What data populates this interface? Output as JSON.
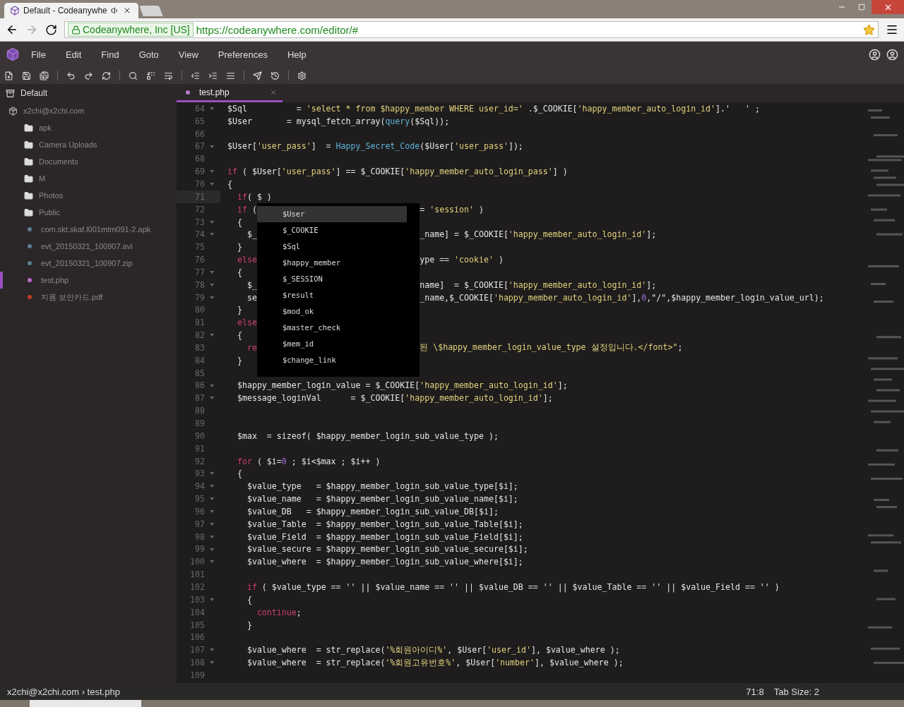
{
  "browser": {
    "tab_title": "Default - Codeanywhe",
    "address_owner": "Codeanywhere, Inc [US]",
    "url": "https://codeanywhere.com/editor/#"
  },
  "menu": [
    {
      "label": "File"
    },
    {
      "label": "Edit"
    },
    {
      "label": "Find"
    },
    {
      "label": "Goto"
    },
    {
      "label": "View"
    },
    {
      "label": "Preferences"
    },
    {
      "label": "Help"
    }
  ],
  "sidebar": {
    "title": "Default",
    "account": "x2chi@x2chi.com",
    "items": [
      {
        "name": "apk",
        "kind": "folder",
        "selected": false
      },
      {
        "name": "Camera Uploads",
        "kind": "folder",
        "selected": false
      },
      {
        "name": "Documents",
        "kind": "folder",
        "selected": false
      },
      {
        "name": "M",
        "kind": "folder",
        "selected": false
      },
      {
        "name": "Photos",
        "kind": "folder",
        "selected": false
      },
      {
        "name": "Public",
        "kind": "folder",
        "selected": false
      },
      {
        "name": "com.skt.skaf.l001mtm091-2.apk",
        "kind": "file",
        "selected": false
      },
      {
        "name": "evt_20150321_100907.avi",
        "kind": "file",
        "selected": false
      },
      {
        "name": "evt_20150321_100907.zip",
        "kind": "file",
        "selected": false
      },
      {
        "name": "test.php",
        "kind": "php",
        "selected": true
      },
      {
        "name": "지름 보안카드.pdf",
        "kind": "pdf",
        "selected": false
      }
    ]
  },
  "editor_tabs": [
    {
      "label": "test.php",
      "selected": true
    }
  ],
  "code": {
    "lines": [
      {
        "number": "64",
        "fold": true,
        "active": false,
        "tokens": [
          {
            "kind": "plain",
            "text": "$Sql          = "
          },
          {
            "kind": "str",
            "text": "'select * from $happy_member WHERE user_id='"
          },
          {
            "kind": "plain",
            "text": " .$_COOKIE["
          },
          {
            "kind": "str",
            "text": "'happy_member_auto_login_id'"
          },
          {
            "kind": "plain",
            "text": "].'   ' ;"
          }
        ]
      },
      {
        "number": "65",
        "fold": false,
        "active": false,
        "tokens": [
          {
            "kind": "plain",
            "text": "$User       = mysql_fetch_array("
          },
          {
            "kind": "fn",
            "text": "query"
          },
          {
            "kind": "plain",
            "text": "($Sql));"
          }
        ]
      },
      {
        "number": "66",
        "fold": false,
        "active": false
      },
      {
        "number": "67",
        "fold": true,
        "active": false,
        "tokens": [
          {
            "kind": "plain",
            "text": "$User["
          },
          {
            "kind": "str",
            "text": "'user_pass'"
          },
          {
            "kind": "plain",
            "text": "]  = "
          },
          {
            "kind": "fn",
            "text": "Happy_Secret_Code"
          },
          {
            "kind": "plain",
            "text": "($User["
          },
          {
            "kind": "str",
            "text": "'user_pass'"
          },
          {
            "kind": "plain",
            "text": "]);"
          }
        ]
      },
      {
        "number": "68",
        "fold": false,
        "active": false
      },
      {
        "number": "69",
        "fold": true,
        "active": false,
        "tokens": [
          {
            "kind": "kw",
            "text": "if"
          },
          {
            "kind": "plain",
            "text": " ( $User["
          },
          {
            "kind": "str",
            "text": "'user_pass'"
          },
          {
            "kind": "plain",
            "text": "] == $_COOKIE["
          },
          {
            "kind": "str",
            "text": "'happy_member_auto_login_pass'"
          },
          {
            "kind": "plain",
            "text": "] )"
          }
        ]
      },
      {
        "number": "70",
        "fold": true,
        "active": false,
        "tokens": [
          {
            "kind": "plain",
            "text": "{"
          }
        ]
      },
      {
        "number": "71",
        "fold": false,
        "active": true,
        "tokens": [
          {
            "kind": "kw",
            "text": "  if"
          },
          {
            "kind": "plain",
            "text": "( $ )"
          }
        ]
      },
      {
        "number": "72",
        "fold": false,
        "active": false,
        "tokens": [
          {
            "kind": "kw",
            "text": "  if"
          },
          {
            "kind": "plain",
            "text": " ("
          }
        ],
        "after": [
          {
            "kind": "plain",
            "text": "= "
          },
          {
            "kind": "str",
            "text": "'session'"
          },
          {
            "kind": "plain",
            "text": " )"
          }
        ]
      },
      {
        "number": "73",
        "fold": true,
        "active": false,
        "tokens": [
          {
            "kind": "plain",
            "text": "  {"
          }
        ]
      },
      {
        "number": "74",
        "fold": true,
        "active": false,
        "tokens": [
          {
            "kind": "plain",
            "text": "    $_"
          }
        ],
        "after": [
          {
            "kind": "plain",
            "text": "_name] = $_COOKIE["
          },
          {
            "kind": "str",
            "text": "'happy_member_auto_login_id'"
          },
          {
            "kind": "plain",
            "text": "];"
          }
        ]
      },
      {
        "number": "75",
        "fold": false,
        "active": false,
        "tokens": [
          {
            "kind": "plain",
            "text": "  }"
          }
        ]
      },
      {
        "number": "76",
        "fold": false,
        "active": false,
        "tokens": [
          {
            "kind": "kw",
            "text": "  else"
          }
        ],
        "after": [
          {
            "kind": "plain",
            "text": "ype == "
          },
          {
            "kind": "str",
            "text": "'cookie'"
          },
          {
            "kind": "plain",
            "text": " )"
          }
        ]
      },
      {
        "number": "77",
        "fold": true,
        "active": false,
        "tokens": [
          {
            "kind": "plain",
            "text": "  {"
          }
        ]
      },
      {
        "number": "78",
        "fold": true,
        "active": false,
        "tokens": [
          {
            "kind": "plain",
            "text": "    $_"
          }
        ],
        "after": [
          {
            "kind": "plain",
            "text": "name]  = $_COOKIE["
          },
          {
            "kind": "str",
            "text": "'happy_member_auto_login_id'"
          },
          {
            "kind": "plain",
            "text": "];"
          }
        ]
      },
      {
        "number": "79",
        "fold": true,
        "active": false,
        "tokens": [
          {
            "kind": "plain",
            "text": "    se"
          }
        ],
        "after": [
          {
            "kind": "plain",
            "text": "_name,$_COOKIE["
          },
          {
            "kind": "str",
            "text": "'happy_member_auto_login_id'"
          },
          {
            "kind": "plain",
            "text": "],"
          },
          {
            "kind": "num",
            "text": "0"
          },
          {
            "kind": "plain",
            "text": ",\"/\",$happy_member_login_value_url);"
          }
        ]
      },
      {
        "number": "80",
        "fold": false,
        "active": false,
        "tokens": [
          {
            "kind": "plain",
            "text": "  }"
          }
        ]
      },
      {
        "number": "81",
        "fold": false,
        "active": false,
        "tokens": [
          {
            "kind": "kw",
            "text": "  else"
          }
        ]
      },
      {
        "number": "82",
        "fold": true,
        "active": false,
        "tokens": [
          {
            "kind": "plain",
            "text": "  {"
          }
        ]
      },
      {
        "number": "83",
        "fold": false,
        "active": false,
        "tokens": [
          {
            "kind": "kw",
            "text": "    re"
          }
        ],
        "after": [
          {
            "kind": "str",
            "text": "된 \\$happy_member_login_value_type 설정입니다.</font>\""
          },
          {
            "kind": "plain",
            "text": ";"
          }
        ]
      },
      {
        "number": "84",
        "fold": false,
        "active": false,
        "tokens": [
          {
            "kind": "plain",
            "text": "  }"
          }
        ]
      },
      {
        "number": "85",
        "fold": false,
        "active": false
      },
      {
        "number": "86",
        "fold": true,
        "active": false,
        "tokens": [
          {
            "kind": "plain",
            "text": "  $happy_member_login_value = $_COOKIE["
          },
          {
            "kind": "str",
            "text": "'happy_member_auto_login_id'"
          },
          {
            "kind": "plain",
            "text": "];"
          }
        ]
      },
      {
        "number": "87",
        "fold": true,
        "active": false,
        "tokens": [
          {
            "kind": "plain",
            "text": "  $message_loginVal      = $_COOKIE["
          },
          {
            "kind": "str",
            "text": "'happy_member_auto_login_id'"
          },
          {
            "kind": "plain",
            "text": "];"
          }
        ]
      },
      {
        "number": "88",
        "fold": false,
        "active": false
      },
      {
        "number": "89",
        "fold": false,
        "active": false
      },
      {
        "number": "90",
        "fold": false,
        "active": false,
        "tokens": [
          {
            "kind": "plain",
            "text": "  $max  = sizeof( $happy_member_login_sub_value_type );"
          }
        ]
      },
      {
        "number": "91",
        "fold": false,
        "active": false
      },
      {
        "number": "92",
        "fold": false,
        "active": false,
        "tokens": [
          {
            "kind": "kw",
            "text": "  for"
          },
          {
            "kind": "plain",
            "text": " ( $i="
          },
          {
            "kind": "num",
            "text": "0"
          },
          {
            "kind": "plain",
            "text": " ; $i<$max ; $i++ )"
          }
        ]
      },
      {
        "number": "93",
        "fold": true,
        "active": false,
        "tokens": [
          {
            "kind": "plain",
            "text": "  {"
          }
        ]
      },
      {
        "number": "94",
        "fold": true,
        "active": false,
        "tokens": [
          {
            "kind": "plain",
            "text": "    $value_type   = $happy_member_login_sub_value_type[$i];"
          }
        ]
      },
      {
        "number": "95",
        "fold": true,
        "active": false,
        "tokens": [
          {
            "kind": "plain",
            "text": "    $value_name   = $happy_member_login_sub_value_name[$i];"
          }
        ]
      },
      {
        "number": "96",
        "fold": true,
        "active": false,
        "tokens": [
          {
            "kind": "plain",
            "text": "    $value_DB   = $happy_member_login_sub_value_DB[$i];"
          }
        ]
      },
      {
        "number": "97",
        "fold": true,
        "active": false,
        "tokens": [
          {
            "kind": "plain",
            "text": "    $value_Table  = $happy_member_login_sub_value_Table[$i];"
          }
        ]
      },
      {
        "number": "98",
        "fold": true,
        "active": false,
        "tokens": [
          {
            "kind": "plain",
            "text": "    $value_Field  = $happy_member_login_sub_value_Field[$i];"
          }
        ]
      },
      {
        "number": "99",
        "fold": true,
        "active": false,
        "tokens": [
          {
            "kind": "plain",
            "text": "    $value_secure = $happy_member_login_sub_value_secure[$i];"
          }
        ]
      },
      {
        "number": "100",
        "fold": true,
        "active": false,
        "tokens": [
          {
            "kind": "plain",
            "text": "    $value_where  = $happy_member_login_sub_value_where[$i];"
          }
        ]
      },
      {
        "number": "101",
        "fold": false,
        "active": false
      },
      {
        "number": "102",
        "fold": false,
        "active": false,
        "tokens": [
          {
            "kind": "kw",
            "text": "    if"
          },
          {
            "kind": "plain",
            "text": " ( $value_type == '' || $value_name == '' || $value_DB == '' || $value_Table == '' || $value_Field == '' )"
          }
        ]
      },
      {
        "number": "103",
        "fold": true,
        "active": false,
        "tokens": [
          {
            "kind": "plain",
            "text": "    {"
          }
        ]
      },
      {
        "number": "104",
        "fold": false,
        "active": false,
        "tokens": [
          {
            "kind": "kw",
            "text": "      continue"
          },
          {
            "kind": "plain",
            "text": ";"
          }
        ]
      },
      {
        "number": "105",
        "fold": false,
        "active": false,
        "tokens": [
          {
            "kind": "plain",
            "text": "    }"
          }
        ]
      },
      {
        "number": "106",
        "fold": false,
        "active": false
      },
      {
        "number": "107",
        "fold": true,
        "active": false,
        "tokens": [
          {
            "kind": "plain",
            "text": "    $value_where  = str_replace("
          },
          {
            "kind": "str",
            "text": "'%회원아이디%'"
          },
          {
            "kind": "plain",
            "text": ", $User["
          },
          {
            "kind": "str",
            "text": "'user_id'"
          },
          {
            "kind": "plain",
            "text": "], $value_where );"
          }
        ]
      },
      {
        "number": "108",
        "fold": true,
        "active": false,
        "tokens": [
          {
            "kind": "plain",
            "text": "    $value_where  = str_replace("
          },
          {
            "kind": "str",
            "text": "'%회원고유번호%'"
          },
          {
            "kind": "plain",
            "text": ", $User["
          },
          {
            "kind": "str",
            "text": "'number'"
          },
          {
            "kind": "plain",
            "text": "], $value_where );"
          }
        ]
      },
      {
        "number": "109",
        "fold": false,
        "active": false
      }
    ]
  },
  "autocomplete": [
    {
      "label": "$User",
      "selected": true
    },
    {
      "label": "$_COOKIE",
      "selected": false
    },
    {
      "label": "$Sql",
      "selected": false
    },
    {
      "label": "$happy_member",
      "selected": false
    },
    {
      "label": "$_SESSION",
      "selected": false
    },
    {
      "label": "$result",
      "selected": false
    },
    {
      "label": "$mod_ok",
      "selected": false
    },
    {
      "label": "$master_check",
      "selected": false
    },
    {
      "label": "$mem_id",
      "selected": false
    },
    {
      "label": "$change_link",
      "selected": false
    }
  ],
  "status_bar": {
    "path": "x2chi@x2chi.com › test.php",
    "cursor": "71:8",
    "tab_size": "Tab Size: 2"
  }
}
